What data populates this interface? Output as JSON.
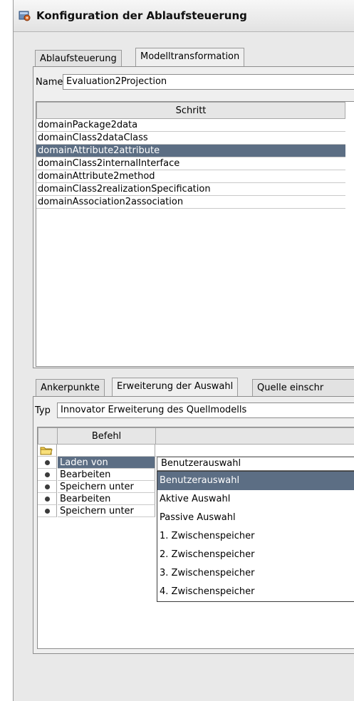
{
  "window": {
    "title": "Konfiguration der Ablaufsteuerung",
    "icon": "configuration-gear-icon"
  },
  "top_tabs": [
    {
      "label": "Ablaufsteuerung",
      "active": false
    },
    {
      "label": "Modelltransformation",
      "active": true
    }
  ],
  "name_field": {
    "label": "Name",
    "value": "Evaluation2Projection"
  },
  "steps_table": {
    "column": "Schritt",
    "rows": [
      "domainPackage2data",
      "domainClass2dataClass",
      "domainAttribute2attribute",
      "domainClass2internalInterface",
      "domainAttribute2method",
      "domainClass2realizationSpecification",
      "domainAssociation2association"
    ],
    "selected_index": 2
  },
  "bottom_tabs": [
    {
      "label": "Ankerpunkte",
      "active": false
    },
    {
      "label": "Erweiterung der Auswahl",
      "active": true
    },
    {
      "label": "Quelle einschr",
      "active": false
    }
  ],
  "type_field": {
    "label": "Typ",
    "value": "Innovator Erweiterung des Quellmodells"
  },
  "commands_table": {
    "columns": [
      "Befehl",
      ""
    ],
    "folder_icon": "folder-icon",
    "rows": [
      "Laden von",
      "Bearbeiten",
      "Speichern unter",
      "Bearbeiten",
      "Speichern unter"
    ],
    "selected_index": 0
  },
  "source_combo": {
    "value": "Benutzerauswahl",
    "options": [
      "Benutzerauswahl",
      "Aktive Auswahl",
      "Passive Auswahl",
      "1. Zwischenspeicher",
      "2. Zwischenspeicher",
      "3. Zwischenspeicher",
      "4. Zwischenspeicher"
    ],
    "highlighted_index": 0
  },
  "colors": {
    "selection": "#5c6e84",
    "panel": "#efefef",
    "border": "#8d8d8d"
  }
}
